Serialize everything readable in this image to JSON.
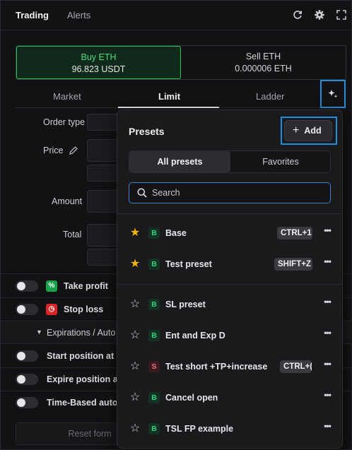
{
  "topbar": {
    "tabs": [
      {
        "label": "Trading"
      },
      {
        "label": "Alerts"
      }
    ],
    "icons": [
      "refresh-icon",
      "gear-icon",
      "expand-icon"
    ]
  },
  "sides": {
    "buy": {
      "label": "Buy ETH",
      "amount": "96.823 USDT"
    },
    "sell": {
      "label": "Sell ETH",
      "amount": "0.000006 ETH"
    }
  },
  "order_tabs": [
    {
      "label": "Market"
    },
    {
      "label": "Limit"
    },
    {
      "label": "Ladder"
    }
  ],
  "form": {
    "order_type_label": "Order type",
    "price_label": "Price",
    "amount_label": "Amount",
    "total_label": "Total",
    "take_profit_label": "Take profit",
    "stop_loss_label": "Stop loss",
    "expirations_label": "Expirations / Auto clo",
    "start_position_label": "Start position at",
    "expire_position_label": "Expire position at",
    "time_based_label": "Time-Based auto c",
    "reset_label": "Reset form"
  },
  "presets": {
    "title": "Presets",
    "add_label": "Add",
    "segments": [
      {
        "label": "All presets"
      },
      {
        "label": "Favorites"
      }
    ],
    "search_placeholder": "Search",
    "favorites": [
      {
        "name": "Base",
        "side": "B",
        "hotkey": "CTRL+1",
        "starred": true
      },
      {
        "name": "Test preset",
        "side": "B",
        "hotkey": "SHIFT+Z",
        "starred": true
      }
    ],
    "items": [
      {
        "name": "SL preset",
        "side": "B",
        "hotkey": "",
        "starred": false
      },
      {
        "name": "Ent and Exp D",
        "side": "B",
        "hotkey": "",
        "starred": false
      },
      {
        "name": "Test short +TP+increase",
        "side": "S",
        "hotkey": "CTRL+(",
        "starred": false
      },
      {
        "name": "Cancel open",
        "side": "B",
        "hotkey": "",
        "starred": false
      },
      {
        "name": "TSL FP example",
        "side": "B",
        "hotkey": "",
        "starred": false
      }
    ]
  },
  "colors": {
    "buy_accent": "#22c55e",
    "favorite_star": "#f5b50a",
    "highlight_outline": "#1c8fe0",
    "sell_badge": "#f0707c"
  }
}
